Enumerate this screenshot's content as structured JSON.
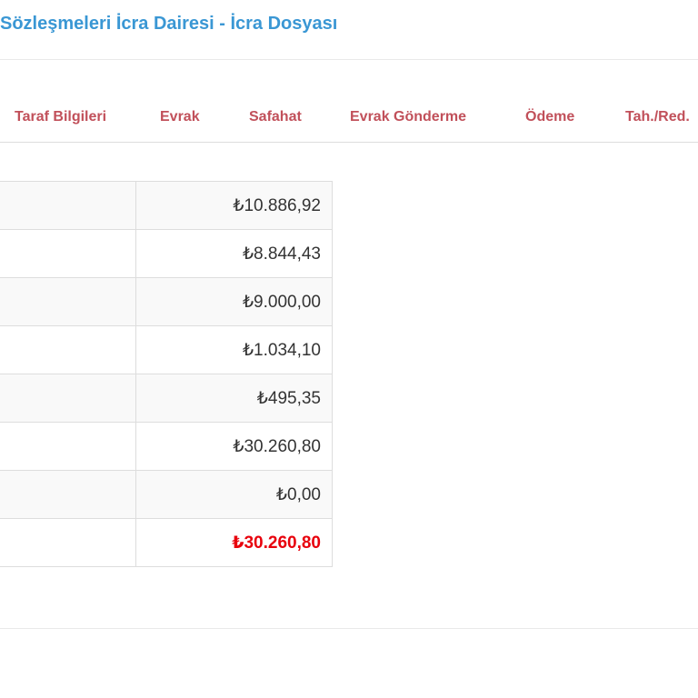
{
  "header": {
    "title": "Sözleşmeleri İcra Dairesi - İcra Dosyası"
  },
  "tabs": [
    {
      "label": "Taraf Bilgileri"
    },
    {
      "label": "Evrak"
    },
    {
      "label": "Safahat"
    },
    {
      "label": "Evrak Gönderme"
    },
    {
      "label": "Ödeme"
    },
    {
      "label": "Tah./Red."
    }
  ],
  "table": {
    "rows": [
      {
        "label": "",
        "value": "₺10.886,92"
      },
      {
        "label": "",
        "value": "₺8.844,43"
      },
      {
        "label": "",
        "value": "₺9.000,00"
      },
      {
        "label": "",
        "value": "₺1.034,10"
      },
      {
        "label": "",
        "value": "₺495,35"
      },
      {
        "label": "",
        "value": "₺30.260,80"
      },
      {
        "label": "",
        "value": "₺0,00"
      },
      {
        "label": "",
        "value": "₺30.260,80"
      }
    ]
  },
  "colors": {
    "title": "#3a97d4",
    "tab": "#c1505a",
    "total": "#e8000c"
  }
}
